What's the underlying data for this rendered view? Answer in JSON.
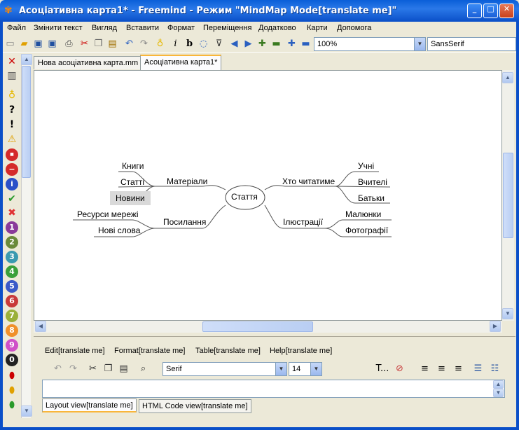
{
  "window": {
    "title": "Асоціативна карта1* - Freemind - Режим \"MindMap Mode[translate me]\"",
    "minimize": "_",
    "maximize": "□",
    "close": "✕"
  },
  "menu": [
    "Файл",
    "Змінити текст",
    "Вигляд",
    "Вставити",
    "Формат",
    "Переміщення",
    "Додатково",
    "Карти",
    "Допомога"
  ],
  "toolbar": {
    "zoom": "100%",
    "font": "SansSerif"
  },
  "tabs": [
    "Нова асоціативна карта.mm",
    "Асоціативна карта1*"
  ],
  "mindmap": {
    "root": "Стаття",
    "left": [
      {
        "label": "Матеріали",
        "children": [
          "Книги",
          "Статті",
          "Новини"
        ]
      },
      {
        "label": "Посилання",
        "children": [
          "Ресурси мережі",
          "Нові слова"
        ]
      }
    ],
    "right": [
      {
        "label": "Хто читатиме",
        "children": [
          "Учні",
          "Вчителі",
          "Батьки"
        ]
      },
      {
        "label": "Ілюстрації",
        "children": [
          "Малюнки",
          "Фотографії"
        ]
      }
    ],
    "selected": "Новини"
  },
  "editor": {
    "menu": [
      "Edit[translate me]",
      "Format[translate me]",
      "Table[translate me]",
      "Help[translate me]"
    ],
    "font": "Serif",
    "size": "14",
    "text_label": "T...",
    "tabs": [
      "Layout view[translate me]",
      "HTML Code view[translate me]"
    ]
  },
  "colors": {
    "title_bar": "#0a5fd8",
    "active_tab": "#f9b63a",
    "selected_node": "#d9d9d9"
  }
}
